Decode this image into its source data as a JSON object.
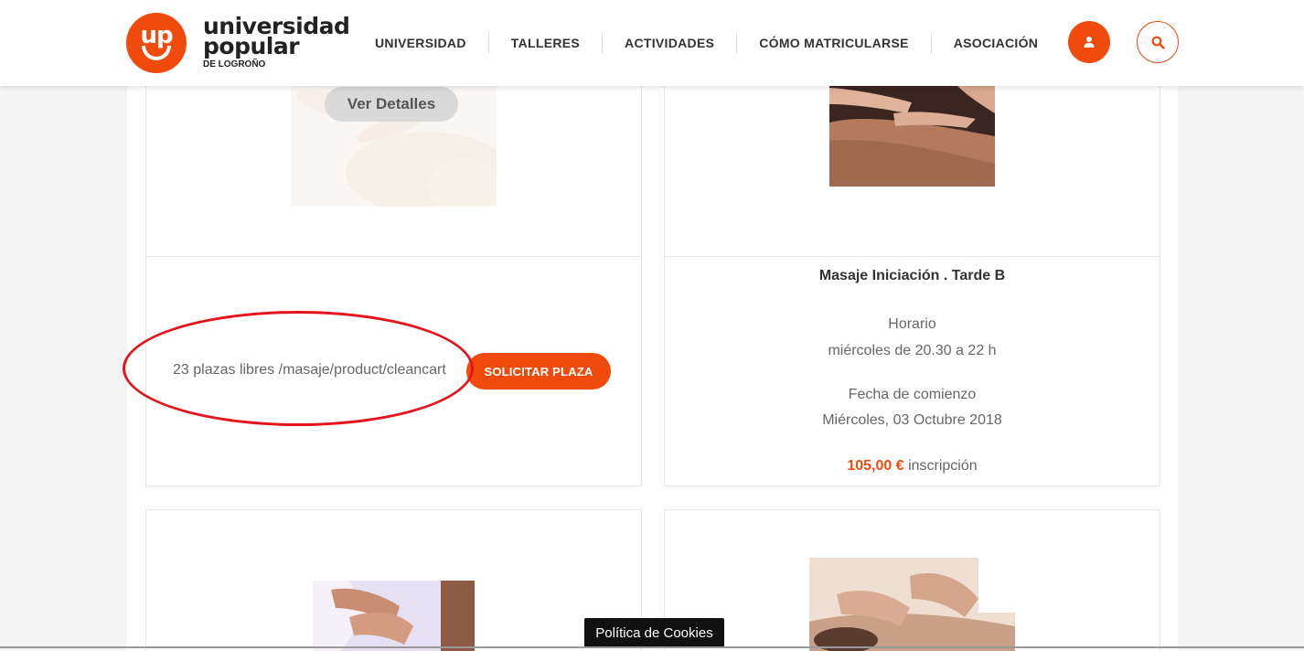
{
  "brand": {
    "logo_mark": "up",
    "line1": "universidad",
    "line2": "popular",
    "line3": "DE LOGROÑO",
    "accent_color": "#f04b0c"
  },
  "nav": {
    "items": [
      {
        "label": "UNIVERSIDAD"
      },
      {
        "label": "TALLERES"
      },
      {
        "label": "ACTIVIDADES"
      },
      {
        "label": "CÓMO MATRICULARSE"
      },
      {
        "label": "ASOCIACIÓN"
      }
    ],
    "user_icon": "user-icon",
    "search_icon": "search-icon"
  },
  "card_left": {
    "details_button": "Ver Detalles",
    "availability": "23 plazas libres /masaje/product/cleancart",
    "cta": "SOLICITAR PLAZA",
    "annotation_color": "#e3141b"
  },
  "card_right": {
    "title": "Masaje Iniciación . Tarde B",
    "schedule_label": "Horario",
    "schedule_value": "miércoles de 20.30 a 22 h",
    "start_label": "Fecha de comienzo",
    "start_value": "Miércoles, 03 Octubre 2018",
    "price": "105,00 €",
    "price_suffix": "inscripción"
  },
  "cookie_notice": "Política de Cookies"
}
